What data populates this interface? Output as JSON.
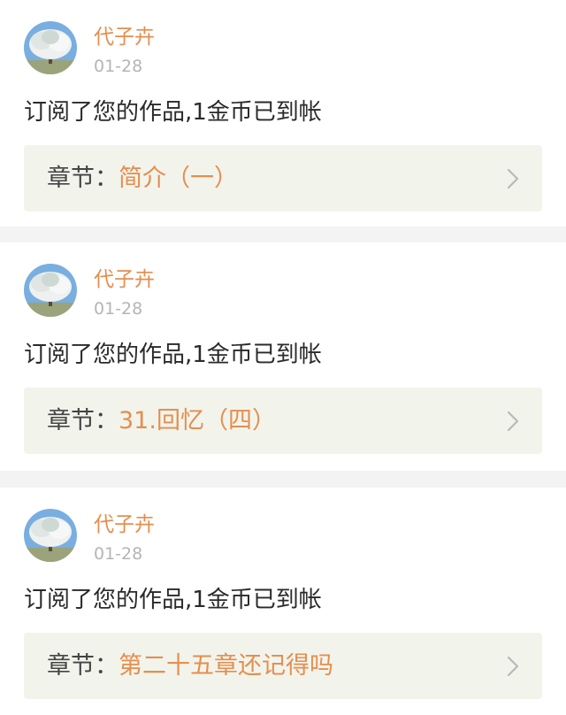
{
  "notifications": [
    {
      "username": "代子卉",
      "date": "01-28",
      "message": "订阅了您的作品,1金币已到帐",
      "chapter_label": "章节：",
      "chapter_title": "简介（一）"
    },
    {
      "username": "代子卉",
      "date": "01-28",
      "message": "订阅了您的作品,1金币已到帐",
      "chapter_label": "章节：",
      "chapter_title": "31.回忆（四）"
    },
    {
      "username": "代子卉",
      "date": "01-28",
      "message": "订阅了您的作品,1金币已到帐",
      "chapter_label": "章节：",
      "chapter_title": "第二十五章还记得吗"
    }
  ],
  "icons": {
    "avatar": "tree-photo-avatar",
    "chevron": "chevron-right-icon"
  },
  "colors": {
    "accent": "#e58e4e",
    "muted": "#b5b5b5",
    "text": "#2a2a2a",
    "chapter_bg": "#f2f4ec",
    "divider_bg": "#f3f3f3"
  }
}
